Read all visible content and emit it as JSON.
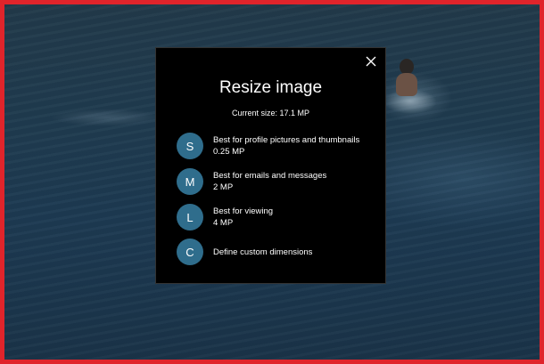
{
  "dialog": {
    "title": "Resize image",
    "current_size": "Current size: 17.1 MP",
    "options": [
      {
        "letter": "S",
        "label": "Best for profile pictures and thumbnails",
        "size": "0.25 MP"
      },
      {
        "letter": "M",
        "label": "Best for emails and messages",
        "size": "2 MP"
      },
      {
        "letter": "L",
        "label": "Best for viewing",
        "size": "4 MP"
      },
      {
        "letter": "C",
        "label": "Define custom dimensions"
      }
    ]
  },
  "colors": {
    "badge": "#2f6d8c",
    "frame": "#e0242b",
    "dialog_bg": "#000000"
  },
  "icons": {
    "close": "close-icon"
  }
}
